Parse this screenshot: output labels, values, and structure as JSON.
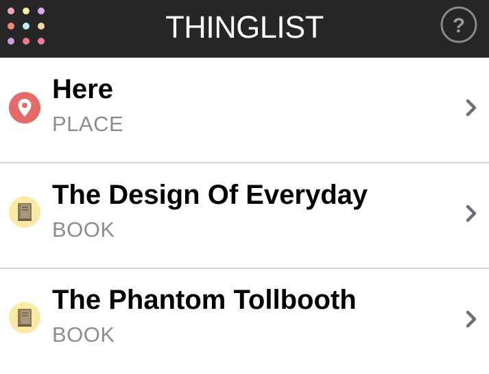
{
  "app": {
    "title": "THINGLIST"
  },
  "header": {
    "menu_icon": "grid-menu-icon",
    "help_icon": "help-icon",
    "help_label": "?",
    "dot_colors": [
      "#f3a7a7",
      "#f5f0a0",
      "#d9a7f0",
      "#f08a7a",
      "#bff0f5",
      "#f5d9a0",
      "#c7a0e0",
      "#f07a8a",
      "#f07a9a"
    ]
  },
  "items": [
    {
      "title": "Here",
      "kind": "PLACE",
      "icon": "location-pin-icon",
      "icon_bg": "#e56b6b"
    },
    {
      "title": "The Design Of Everyday",
      "kind": "BOOK",
      "icon": "book-icon",
      "icon_bg": "#fbeaa5"
    },
    {
      "title": "The Phantom Tollbooth",
      "kind": "BOOK",
      "icon": "book-icon",
      "icon_bg": "#fbeaa5"
    }
  ],
  "colors": {
    "header_bg": "#262626",
    "title_text": "#ffffff",
    "kind_text": "#8c8c8c",
    "chevron": "#6b6f7a",
    "divider": "#d4d4d4"
  }
}
